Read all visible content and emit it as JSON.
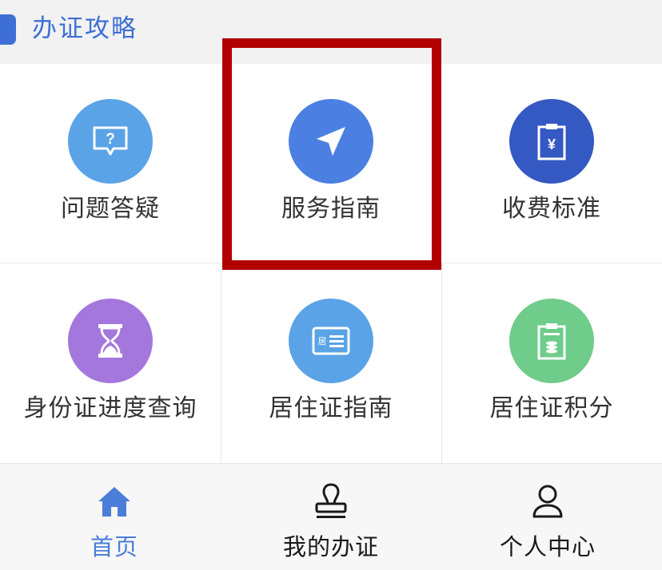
{
  "header": {
    "title": "办证攻略"
  },
  "grid": {
    "items": [
      {
        "label": "问题答疑",
        "icon": "question-bubble-icon",
        "color": "#5aa3e6"
      },
      {
        "label": "服务指南",
        "icon": "send-arrow-icon",
        "color": "#4b80e2"
      },
      {
        "label": "收费标准",
        "icon": "fee-clipboard-icon",
        "color": "#3559c2"
      },
      {
        "label": "身份证进度查询",
        "icon": "hourglass-icon",
        "color": "#a477dd"
      },
      {
        "label": "居住证指南",
        "icon": "residence-card-icon",
        "color": "#5aa3e6"
      },
      {
        "label": "居住证积分",
        "icon": "points-clipboard-icon",
        "color": "#6fcc8a"
      }
    ],
    "highlighted": "服务指南"
  },
  "tabbar": {
    "tabs": [
      {
        "label": "首页",
        "icon": "home-icon",
        "active": true
      },
      {
        "label": "我的办证",
        "icon": "stamp-icon",
        "active": false
      },
      {
        "label": "个人中心",
        "icon": "person-icon",
        "active": false
      }
    ],
    "active_color": "#4a7ed8"
  }
}
